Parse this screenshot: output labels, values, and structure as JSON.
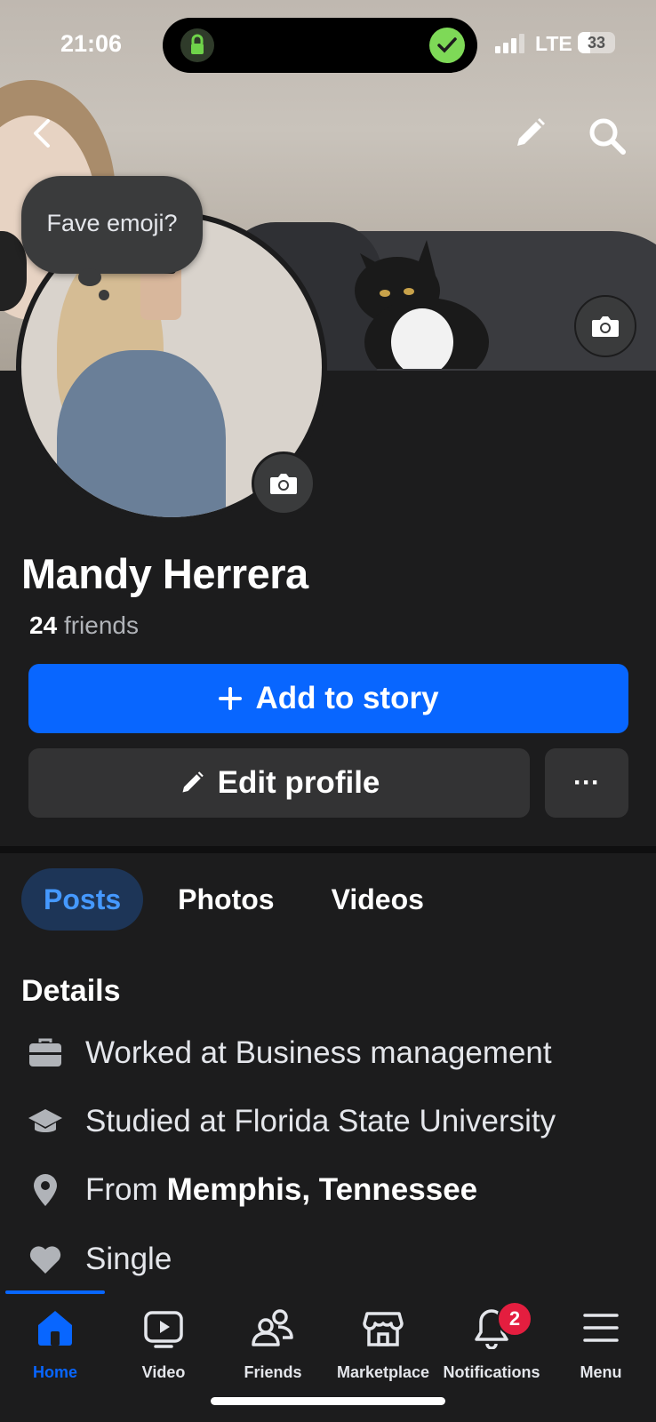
{
  "status_bar": {
    "time": "21:06",
    "network": "LTE",
    "battery": "33",
    "battery_level": 0.33
  },
  "header": {
    "back_icon": "chevron-left-icon",
    "edit_icon": "pencil-icon",
    "search_icon": "search-icon"
  },
  "profile": {
    "note_bubble": "Fave emoji?",
    "name": "Mandy Herrera",
    "friends_count": "24",
    "friends_label": "friends"
  },
  "actions": {
    "add_story": "Add to story",
    "edit_profile": "Edit profile",
    "more": "···"
  },
  "tabs": [
    {
      "label": "Posts",
      "active": true
    },
    {
      "label": "Photos",
      "active": false
    },
    {
      "label": "Videos",
      "active": false
    }
  ],
  "details": {
    "title": "Details",
    "items": [
      {
        "icon": "briefcase-icon",
        "text": "Worked at Business management",
        "bold": ""
      },
      {
        "icon": "graduation-cap-icon",
        "text": "Studied at Florida State University",
        "bold": ""
      },
      {
        "icon": "location-pin-icon",
        "text": "From",
        "bold": "Memphis, Tennessee"
      },
      {
        "icon": "heart-icon",
        "text": "Single",
        "bold": ""
      }
    ]
  },
  "bottom_nav": [
    {
      "label": "Home",
      "icon": "home-icon",
      "active": true
    },
    {
      "label": "Video",
      "icon": "video-icon",
      "active": false
    },
    {
      "label": "Friends",
      "icon": "friends-icon",
      "active": false
    },
    {
      "label": "Marketplace",
      "icon": "marketplace-icon",
      "active": false
    },
    {
      "label": "Notifications",
      "icon": "bell-icon",
      "active": false,
      "badge": "2"
    },
    {
      "label": "Menu",
      "icon": "menu-icon",
      "active": false
    }
  ],
  "colors": {
    "accent": "#0866ff",
    "background": "#1c1c1d",
    "button": "#333334",
    "badge": "#e41e3f"
  }
}
